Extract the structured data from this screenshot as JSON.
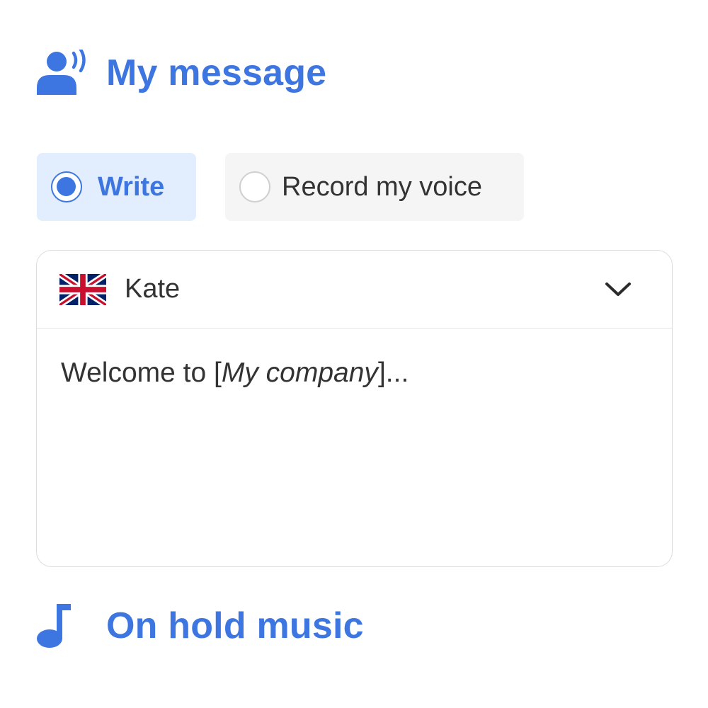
{
  "header": {
    "title": "My message",
    "icon": "person-speaking-icon"
  },
  "mode": {
    "options": [
      {
        "label": "Write",
        "selected": true
      },
      {
        "label": "Record my voice",
        "selected": false
      }
    ]
  },
  "voice": {
    "name": "Kate",
    "flag": "uk-flag-icon",
    "dropdown_icon": "chevron-down-icon"
  },
  "message": {
    "before": "Welcome to [",
    "placeholder_company": "My company",
    "after": "]..."
  },
  "music_section": {
    "title": "On hold music",
    "icon": "music-note-icon"
  },
  "colors": {
    "accent": "#3d76e0",
    "selected_bg": "#e2eefd",
    "unselected_bg": "#f5f5f5"
  }
}
